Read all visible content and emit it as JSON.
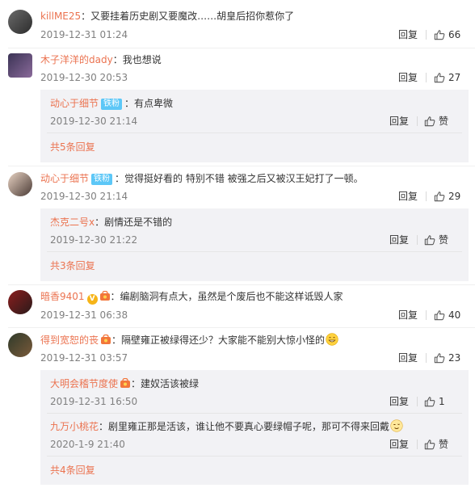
{
  "labels": {
    "reply": "回复",
    "like": "赞",
    "fan_badge": "铁粉"
  },
  "comments": [
    {
      "username": "killME25",
      "text": "：又要挂着历史剧又要魔改……胡皇后招你惹你了",
      "time": "2019-12-31 01:24",
      "likes": "66"
    },
    {
      "username": "木子洋洋的dady",
      "text": "：我也想说",
      "time": "2019-12-30 20:53",
      "likes": "27",
      "subs": [
        {
          "username": "动心于细节",
          "text": "：有点卑微",
          "time": "2019-12-30 21:14",
          "likes": "赞"
        }
      ],
      "more": "共5条回复"
    },
    {
      "username": "动心于细节",
      "text": "：觉得挺好看的 特别不错 被强之后又被汉王妃打了一顿。",
      "time": "2019-12-30 21:14",
      "likes": "29",
      "subs": [
        {
          "username": "杰克二号x",
          "text": "：剧情还是不错的",
          "time": "2019-12-30 21:22",
          "likes": "赞"
        }
      ],
      "more": "共3条回复"
    },
    {
      "username": "暗香9401",
      "text": "：编剧脑洞有点大，虽然是个废后也不能这样诋毁人家",
      "time": "2019-12-31 06:38",
      "likes": "40"
    },
    {
      "username": "得到宽恕的丧",
      "text": "：隔壁雍正被绿得还少？大家能不能别大惊小怪的",
      "time": "2019-12-31 03:57",
      "likes": "23",
      "subs": [
        {
          "username": "大明会稽节度使",
          "text": "：建奴活该被绿",
          "time": "2019-12-31 16:50",
          "likes": "1"
        },
        {
          "username": "九万小桃花",
          "text": "：剧里雍正那是活该，谁让他不要真心要绿帽子呢，那可不得来回戴",
          "time": "2020-1-9 21:40",
          "likes": "赞"
        }
      ],
      "more": "共4条回复"
    }
  ]
}
